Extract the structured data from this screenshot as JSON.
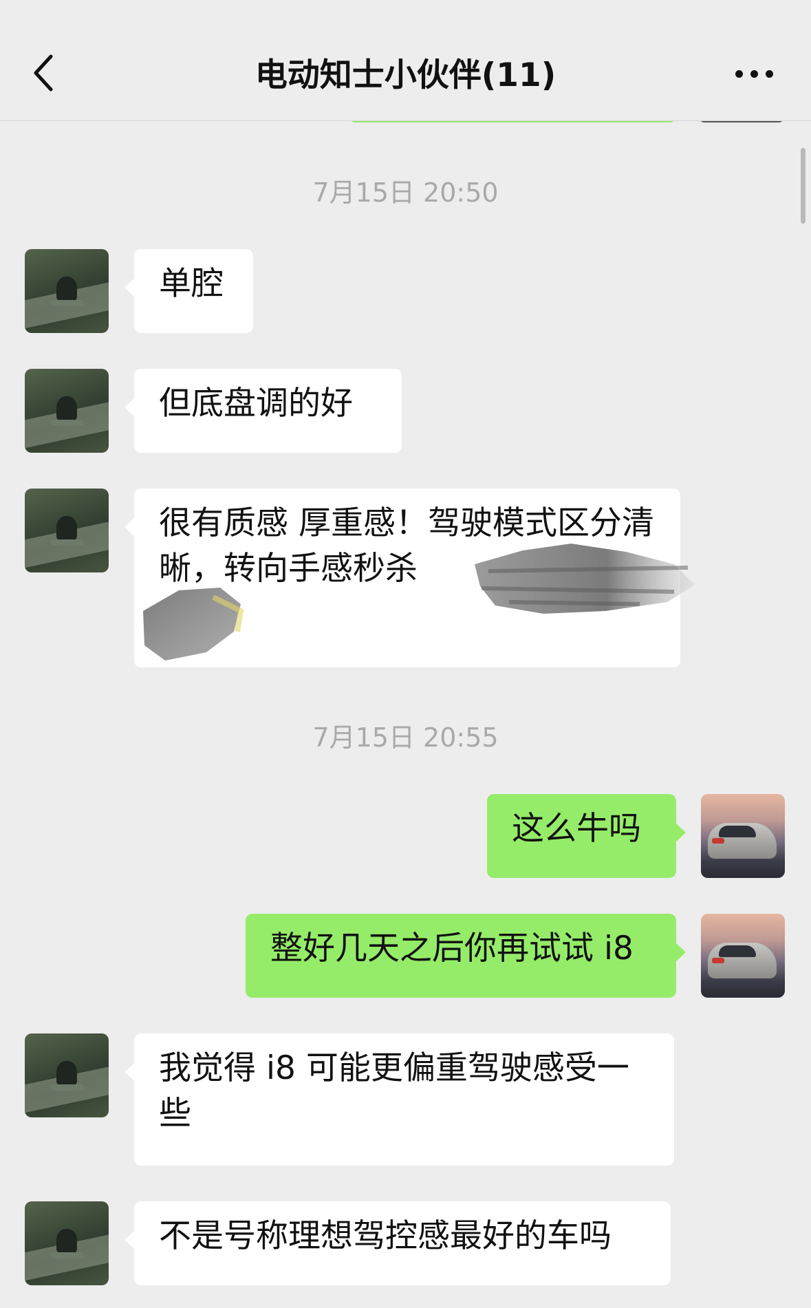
{
  "header": {
    "title": "电动知士小伙伴(11)"
  },
  "messages": {
    "time_1": "7月15日 20:50",
    "m1": "单腔",
    "m2": "但底盘调的好",
    "m3": "很有质感 厚重感！驾驶模式区分清晰，转向手感秒杀",
    "time_2": "7月15日 20:55",
    "m4": "这么牛吗",
    "m5": "整好几天之后你再试试 i8",
    "m6": "我觉得 i8 可能更偏重驾驶感受一些",
    "m7": "不是号称理想驾控感最好的车吗"
  },
  "icons": {
    "back": "chevron-left-icon",
    "more": "more-dots-icon"
  },
  "colors": {
    "background": "#ededed",
    "bubble_received": "#ffffff",
    "bubble_sent": "#95ec69",
    "timestamp": "#a9a9a9"
  }
}
